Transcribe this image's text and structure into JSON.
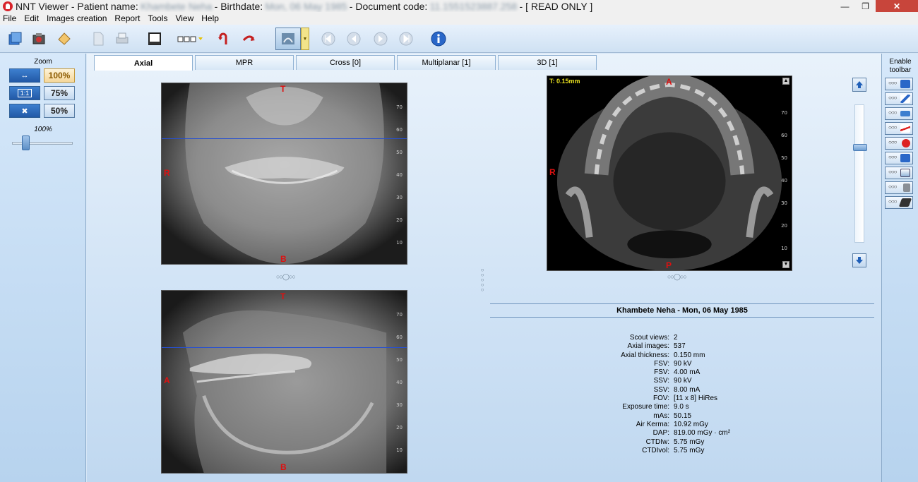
{
  "title": {
    "app": "NNT Viewer - Patient name:",
    "patient_name": "Khambete Neha",
    "birthdate_label": "- Birthdate:",
    "birthdate": "Mon, 06 May 1985",
    "doccode_label": "- Document code:",
    "doccode": "11.1551523887.258",
    "mode": "-  [ READ ONLY ]"
  },
  "menu": [
    "File",
    "Edit",
    "Images creation",
    "Report",
    "Tools",
    "View",
    "Help"
  ],
  "zoom": {
    "label": "Zoom",
    "btn_100": "100%",
    "btn_75": "75%",
    "btn_50": "50%",
    "slider_value": "100%",
    "slider_fraction": 0.22
  },
  "right_toolbar": {
    "label_line1": "Enable",
    "label_line2": "toolbar"
  },
  "tabs": [
    "Axial",
    "MPR",
    "Cross [0]",
    "Multiplanar [1]",
    "3D [1]"
  ],
  "viewports": {
    "top_left": {
      "top": "T",
      "left": "R",
      "bottom": "B"
    },
    "bottom_left": {
      "top": "T",
      "left": "A",
      "bottom": "B"
    },
    "axial": {
      "thickness": "T: 0.15mm",
      "top": "A",
      "left": "R",
      "bottom": "P"
    },
    "ruler_ticks": [
      "70",
      "60",
      "50",
      "40",
      "30",
      "20",
      "10"
    ]
  },
  "info": {
    "header": "Khambete Neha - Mon, 06 May 1985",
    "rows": [
      {
        "k": "Scout views:",
        "v": "2"
      },
      {
        "k": "Axial images:",
        "v": "537"
      },
      {
        "k": "Axial thickness:",
        "v": "0.150 mm"
      },
      {
        "k": "FSV:",
        "v": "90 kV"
      },
      {
        "k": "FSV:",
        "v": "4.00 mA"
      },
      {
        "k": "SSV:",
        "v": "90 kV"
      },
      {
        "k": "SSV:",
        "v": "8.00 mA"
      },
      {
        "k": "FOV:",
        "v": "[11 x 8] HiRes"
      },
      {
        "k": "Exposure time:",
        "v": "9.0 s"
      },
      {
        "k": "mAs:",
        "v": "50.15"
      },
      {
        "k": "Air Kerma:",
        "v": "10.92 mGy"
      },
      {
        "k": "DAP:",
        "v": "819.00 mGy · cm²"
      },
      {
        "k": "CTDIw:",
        "v": "5.75 mGy"
      },
      {
        "k": "CTDIvol:",
        "v": "5.75 mGy"
      }
    ]
  },
  "pager_dots": "○○◯○○",
  "colors": {
    "accent": "#2750d0",
    "label_red": "#d11111",
    "close": "#c8453b"
  }
}
